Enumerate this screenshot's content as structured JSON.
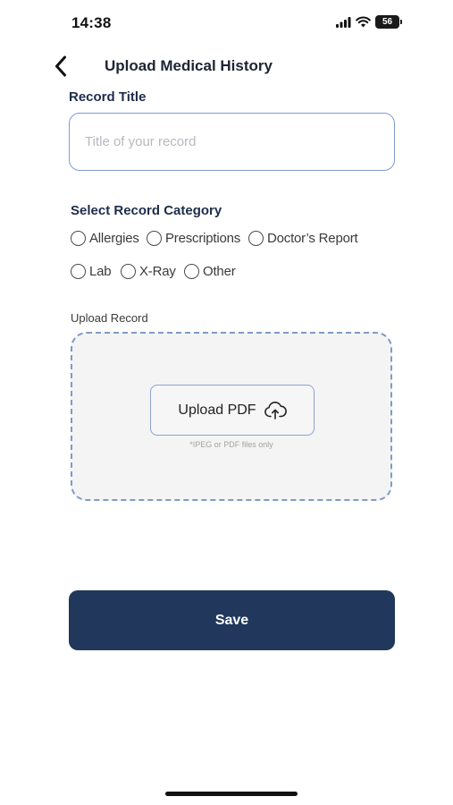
{
  "status_bar": {
    "time": "14:38",
    "battery_level": "56",
    "icons": [
      "cellular-signal-icon",
      "wifi-icon",
      "battery-icon"
    ]
  },
  "nav": {
    "back_icon": "chevron-left-icon",
    "title": "Upload Medical History"
  },
  "record_title": {
    "label": "Record Title",
    "value": "",
    "placeholder": "Title of your record"
  },
  "category": {
    "label": "Select Record Category",
    "options": [
      "Allergies",
      "Prescriptions",
      "Doctor’s Report",
      "Lab",
      "X-Ray",
      "Other"
    ],
    "selected": null
  },
  "upload": {
    "label": "Upload Record",
    "button_label": "Upload PDF",
    "button_icon": "cloud-upload-icon",
    "hint": "*IPEG or PDF files only"
  },
  "save": {
    "label": "Save"
  },
  "colors": {
    "primary": "#21385c",
    "input_border": "#7d9ad6",
    "dropzone_border": "#7f9ac9",
    "dropzone_fill": "#f4f4f4",
    "label_text": "#1e2d4a"
  }
}
